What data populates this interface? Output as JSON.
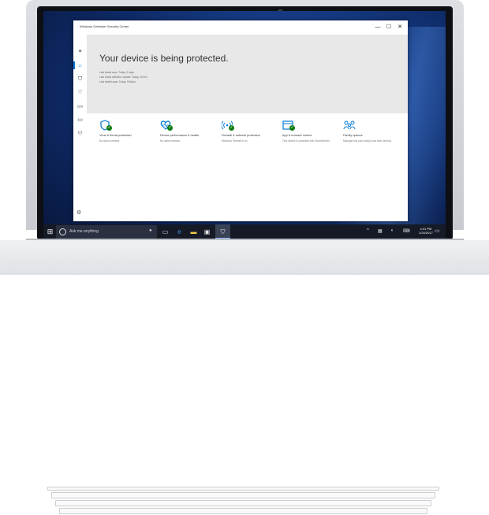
{
  "window": {
    "title": "Windows Defender Security Center",
    "controls": {
      "minimize": "—",
      "maximize": "☐",
      "close": "✕"
    }
  },
  "nav": {
    "items": [
      {
        "name": "menu",
        "glyph": "≡"
      },
      {
        "name": "home",
        "glyph": "⌂"
      },
      {
        "name": "shield",
        "glyph": "⛉"
      },
      {
        "name": "heart",
        "glyph": "♡"
      },
      {
        "name": "network",
        "glyph": "((•))"
      },
      {
        "name": "browser",
        "glyph": "▭"
      },
      {
        "name": "family",
        "glyph": "⚇"
      }
    ],
    "settings_glyph": "⚙"
  },
  "hero": {
    "title": "Your device is being protected.",
    "lines": [
      "Last threat scan: Today, 9 days",
      "Last threat definition update: Today, 15 min",
      "Last health scan: Today, 9:00am"
    ]
  },
  "tiles": [
    {
      "title": "Virus & threat protection",
      "subtitle": "No action needed."
    },
    {
      "title": "Device performance & health",
      "subtitle": "No action needed."
    },
    {
      "title": "Firewall & network protection",
      "subtitle": "Windows Firewall is on."
    },
    {
      "title": "App & browser control",
      "subtitle": "Your device is protected with SmartScreen."
    },
    {
      "title": "Family options",
      "subtitle": "Manage how your family uses their devices."
    }
  ],
  "taskbar": {
    "search_placeholder": "Ask me anything",
    "clock_time": "4:31 PM",
    "clock_date": "1/24/2017"
  },
  "colors": {
    "accent": "#0078d7",
    "status_ok": "#107c10",
    "taskbar": "#151a26"
  }
}
